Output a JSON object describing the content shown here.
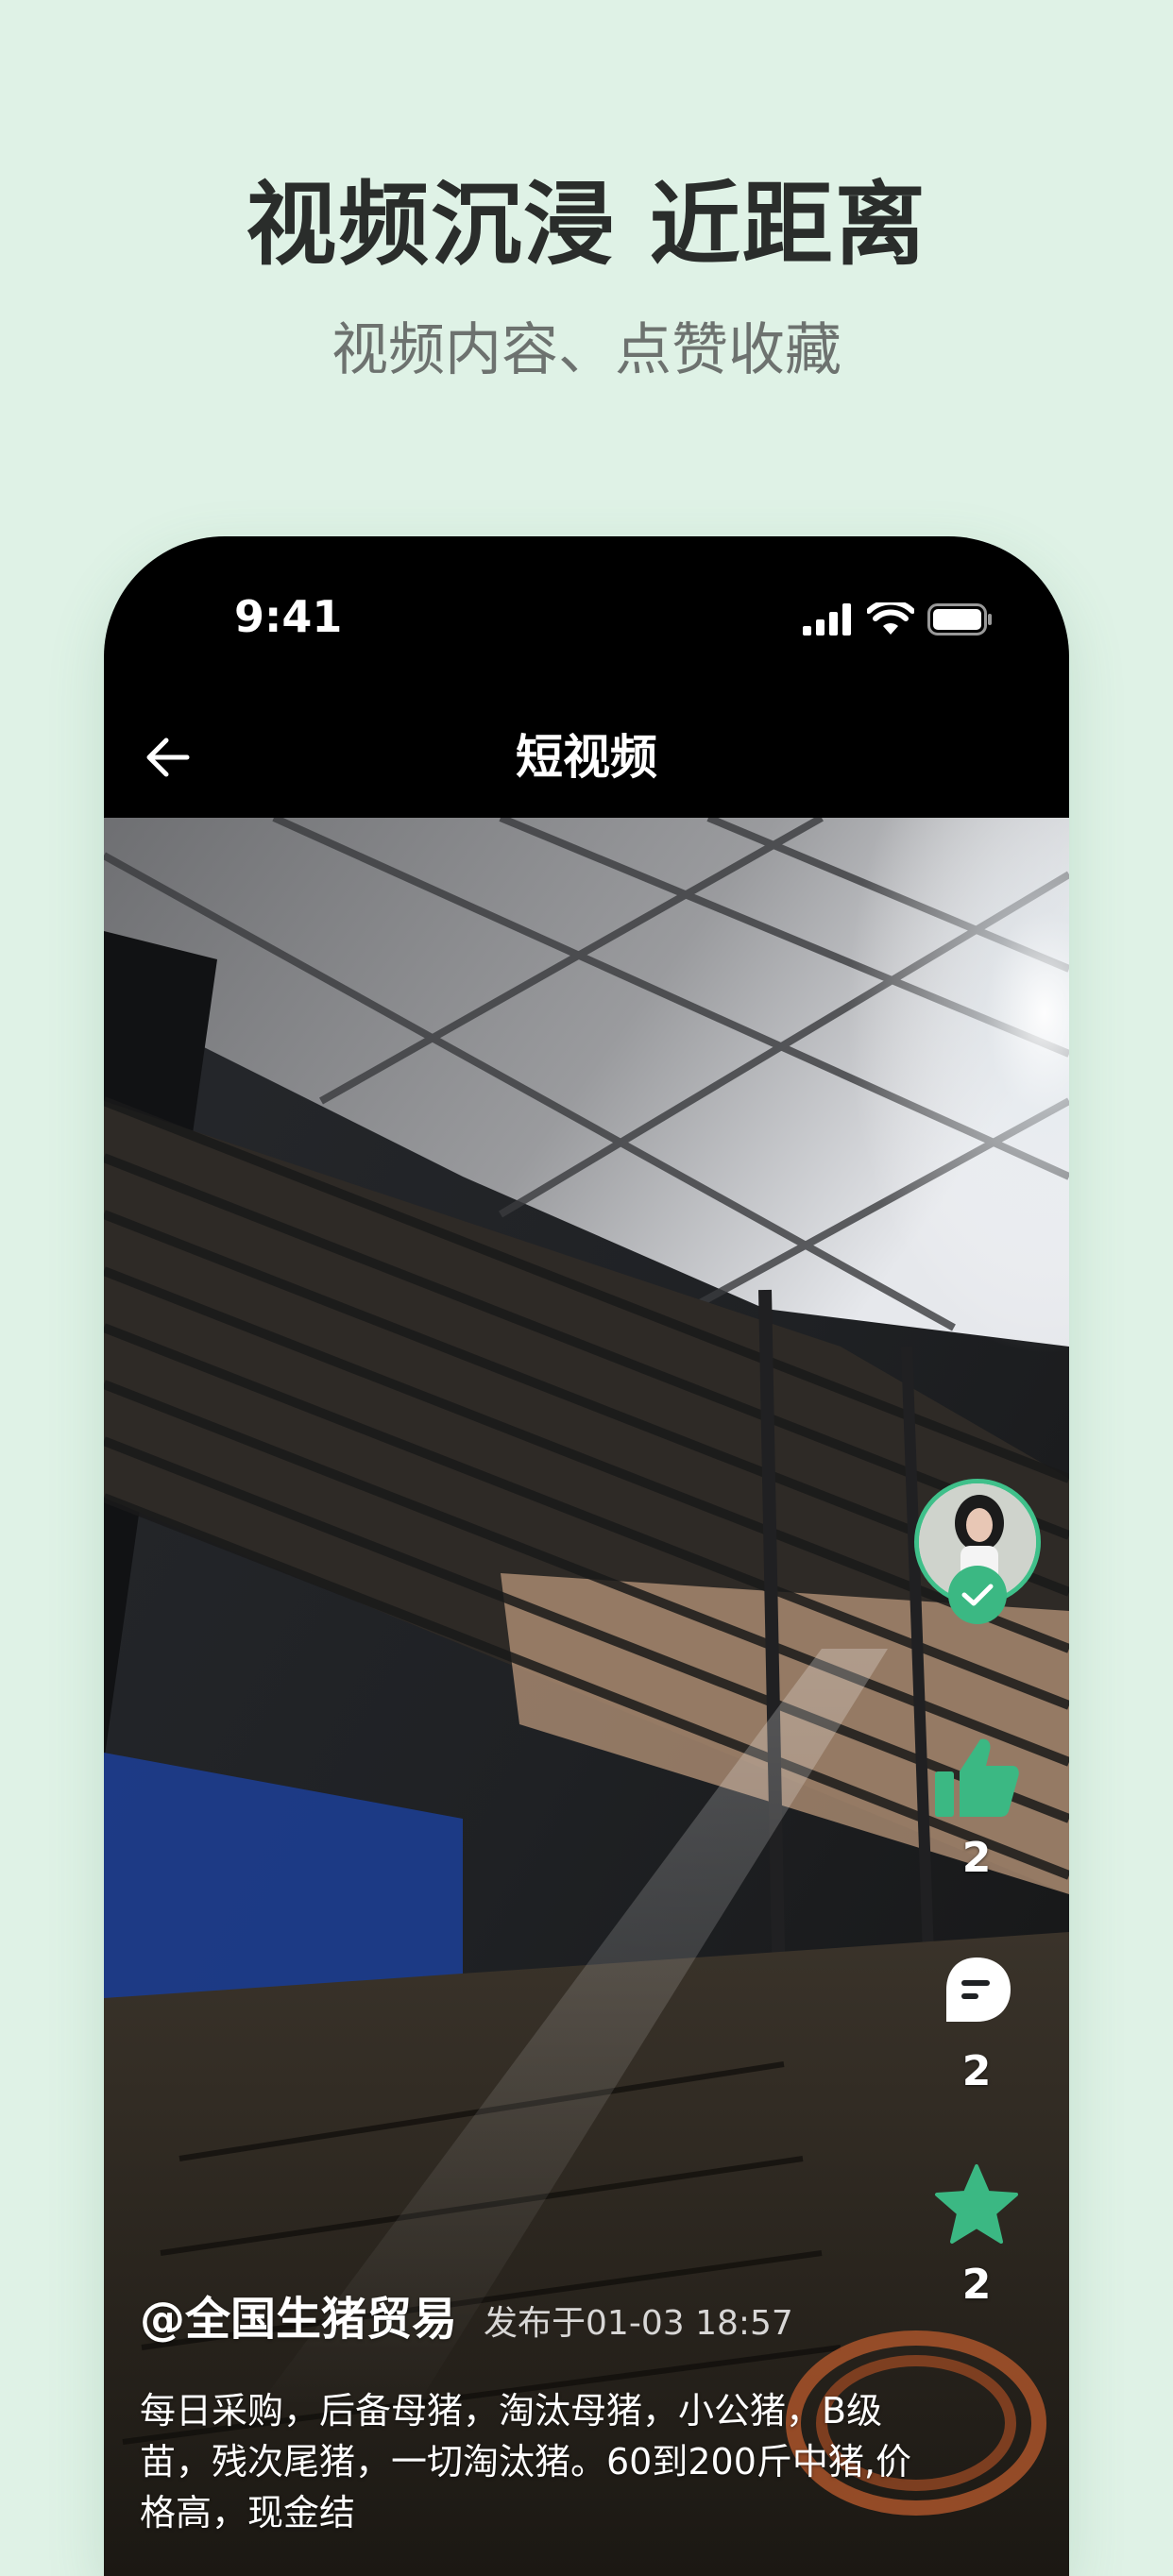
{
  "promo": {
    "title": "视频沉浸 近距离",
    "subtitle": "视频内容、点赞收藏"
  },
  "status_bar": {
    "time": "9:41",
    "icons": [
      "signal-icon",
      "wifi-icon",
      "battery-icon"
    ]
  },
  "nav": {
    "back_icon": "arrow-left-icon",
    "title": "短视频"
  },
  "video": {
    "author": "@全国生猪贸易",
    "publish_time": "发布于01-03 18:57",
    "description": "每日采购，后备母猪，淘汰母猪，小公猪，B级苗，残次尾猪，一切淘汰猪。60到200斤中猪,价格高，现金结"
  },
  "actions": {
    "follow_icon": "check-icon",
    "like": {
      "icon": "thumbs-up-icon",
      "count": "2"
    },
    "comment": {
      "icon": "comment-icon",
      "count": "2"
    },
    "favorite": {
      "icon": "star-icon",
      "count": "2"
    }
  },
  "colors": {
    "background": "#dff2e6",
    "accent": "#3bb883",
    "title": "#2a2d2b",
    "subtitle": "#6d726f"
  }
}
